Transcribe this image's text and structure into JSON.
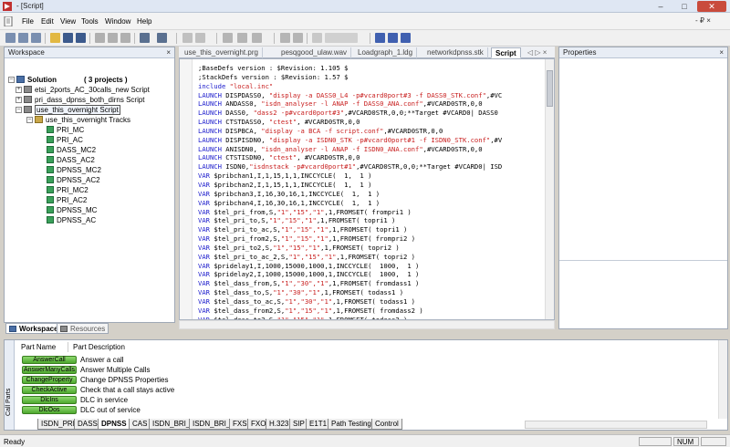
{
  "window": {
    "title": "- [Script]",
    "minimize": "–",
    "maximize": "□",
    "close": "✕"
  },
  "menu": {
    "items": [
      "File",
      "Edit",
      "View",
      "Tools",
      "Window",
      "Help"
    ],
    "mdi_controls": "- ₽ ×"
  },
  "workspace": {
    "title": "Workspace",
    "close": "×",
    "solution_label": "Solution",
    "solution_count": "( 3 projects )",
    "scripts": [
      "etsi_2ports_AC_30calls_new Script",
      "pri_dass_dpnss_both_dirns Script",
      "use_this_overnight Script"
    ],
    "tracks_label": "use_this_overnight Tracks",
    "tracks": [
      "PRI_MC",
      "PRI_AC",
      "DASS_MC2",
      "DASS_AC2",
      "DPNSS_MC2",
      "DPNSS_AC2",
      "PRI_MC2",
      "PRI_AC2",
      "DPNSS_MC",
      "DPNSS_AC"
    ],
    "tabs": [
      "Workspace",
      "Resources"
    ]
  },
  "editor": {
    "tabs": [
      "use_this_overnight.prg",
      "pesqgood_ulaw.wav",
      "Loadgraph_1.ldg",
      "networkdpnss.stk",
      "Script"
    ],
    "active_tab": "Script",
    "tab_nav": "◁ ▷ ×",
    "lines": [
      [
        [
          "cm",
          ";BaseDefs version : $Revision: 1.105 $"
        ]
      ],
      [
        [
          "cm",
          ";StackDefs version : $Revision: 1.57 $"
        ]
      ],
      [
        [
          "kw",
          "include "
        ],
        [
          "st",
          "\"local.inc\""
        ]
      ],
      [
        [
          "kw",
          "LAUNCH "
        ],
        [
          "cm",
          "DISPDASS0, "
        ],
        [
          "st",
          "\"display -a DASS0_L4 -p#vcard0port#3 -f DASS0_STK.conf\""
        ],
        [
          "cm",
          ",#VC"
        ]
      ],
      [
        [
          "kw",
          "LAUNCH "
        ],
        [
          "cm",
          "ANDASS0, "
        ],
        [
          "st",
          "\"isdn_analyser -l ANAP -f DASS0_ANA.conf\""
        ],
        [
          "cm",
          ",#VCARD0STR,0,0"
        ]
      ],
      [
        [
          "kw",
          "LAUNCH "
        ],
        [
          "cm",
          "DASS0, "
        ],
        [
          "st",
          "\"dass2 -p#vcard0port#3\""
        ],
        [
          "cm",
          ",#VCARD0STR,0,0;**Target #VCARD0| DASS0"
        ]
      ],
      [
        [
          "kw",
          "LAUNCH "
        ],
        [
          "cm",
          "CTSTDASS0, "
        ],
        [
          "st",
          "\"ctest\""
        ],
        [
          "cm",
          ", #VCARD0STR,0,0"
        ]
      ],
      [
        [
          "kw",
          "LAUNCH "
        ],
        [
          "cm",
          "DISPBCA, "
        ],
        [
          "st",
          "\"display -a BCA -f script.conf\""
        ],
        [
          "cm",
          ",#VCARD0STR,0,0"
        ]
      ],
      [
        [
          "kw",
          "LAUNCH "
        ],
        [
          "cm",
          "DISPISDN0, "
        ],
        [
          "st",
          "\"display -a ISDN0_STK -p#vcard0port#1 -f ISDN0_STK.conf\""
        ],
        [
          "cm",
          ",#V"
        ]
      ],
      [
        [
          "kw",
          "LAUNCH "
        ],
        [
          "cm",
          "ANISDN0, "
        ],
        [
          "st",
          "\"isdn_analyser -l ANAP -f ISDN0_ANA.conf\""
        ],
        [
          "cm",
          ",#VCARD0STR,0,0"
        ]
      ],
      [
        [
          "kw",
          "LAUNCH "
        ],
        [
          "cm",
          "CTSTISDN0, "
        ],
        [
          "st",
          "\"ctest\""
        ],
        [
          "cm",
          ", #VCARD0STR,0,0"
        ]
      ],
      [
        [
          "kw",
          "LAUNCH "
        ],
        [
          "cm",
          "ISDN0,"
        ],
        [
          "st",
          "\"isdnstack -p#vcard0port#1\""
        ],
        [
          "cm",
          ",#VCARD0STR,0,0;**Target #VCARD0| ISD"
        ]
      ],
      [
        [
          "kw",
          "VAR "
        ],
        [
          "cm",
          "$pribchan1,I,1,15,1,1,INCCYCLE(  1,  1 )"
        ]
      ],
      [
        [
          "kw",
          "VAR "
        ],
        [
          "cm",
          "$pribchan2,I,1,15,1,1,INCCYCLE(  1,  1 )"
        ]
      ],
      [
        [
          "kw",
          "VAR "
        ],
        [
          "cm",
          "$pribchan3,I,16,30,16,1,INCCYCLE(  1,  1 )"
        ]
      ],
      [
        [
          "kw",
          "VAR "
        ],
        [
          "cm",
          "$pribchan4,I,16,30,16,1,INCCYCLE(  1,  1 )"
        ]
      ],
      [
        [
          "kw",
          "VAR "
        ],
        [
          "cm",
          "$tel_pri_from,S,"
        ],
        [
          "st",
          "\"1\",\"15\",\"1\""
        ],
        [
          "cm",
          ",1,FROMSET( frompri1 )"
        ]
      ],
      [
        [
          "kw",
          "VAR "
        ],
        [
          "cm",
          "$tel_pri_to,S,"
        ],
        [
          "st",
          "\"1\",\"15\",\"1\""
        ],
        [
          "cm",
          ",1,FROMSET( topri1 )"
        ]
      ],
      [
        [
          "kw",
          "VAR "
        ],
        [
          "cm",
          "$tel_pri_to_ac,S,"
        ],
        [
          "st",
          "\"1\",\"15\",\"1\""
        ],
        [
          "cm",
          ",1,FROMSET( topri1 )"
        ]
      ],
      [
        [
          "kw",
          "VAR "
        ],
        [
          "cm",
          "$tel_pri_from2,S,"
        ],
        [
          "st",
          "\"1\",\"15\",\"1\""
        ],
        [
          "cm",
          ",1,FROMSET( frompri2 )"
        ]
      ],
      [
        [
          "kw",
          "VAR "
        ],
        [
          "cm",
          "$tel_pri_to2,S,"
        ],
        [
          "st",
          "\"1\",\"15\",\"1\""
        ],
        [
          "cm",
          ",1,FROMSET( topri2 )"
        ]
      ],
      [
        [
          "kw",
          "VAR "
        ],
        [
          "cm",
          "$tel_pri_to_ac_2,S,"
        ],
        [
          "st",
          "\"1\",\"15\",\"1\""
        ],
        [
          "cm",
          ",1,FROMSET( topri2 )"
        ]
      ],
      [
        [
          "kw",
          "VAR "
        ],
        [
          "cm",
          "$pridelay1,I,1000,15000,1000,1,INCCYCLE(  1000,  1 )"
        ]
      ],
      [
        [
          "kw",
          "VAR "
        ],
        [
          "cm",
          "$pridelay2,I,1000,15000,1000,1,INCCYCLE(  1000,  1 )"
        ]
      ],
      [
        [
          "kw",
          "VAR "
        ],
        [
          "cm",
          "$tel_dass_from,S,"
        ],
        [
          "st",
          "\"1\",\"30\",\"1\""
        ],
        [
          "cm",
          ",1,FROMSET( fromdass1 )"
        ]
      ],
      [
        [
          "kw",
          "VAR "
        ],
        [
          "cm",
          "$tel_dass_to,S,"
        ],
        [
          "st",
          "\"1\",\"30\",\"1\""
        ],
        [
          "cm",
          ",1,FROMSET( todass1 )"
        ]
      ],
      [
        [
          "kw",
          "VAR "
        ],
        [
          "cm",
          "$tel_dass_to_ac,S,"
        ],
        [
          "st",
          "\"1\",\"30\",\"1\""
        ],
        [
          "cm",
          ",1,FROMSET( todass1 )"
        ]
      ],
      [
        [
          "kw",
          "VAR "
        ],
        [
          "cm",
          "$tel_dass_from2,S,"
        ],
        [
          "st",
          "\"1\",\"15\",\"1\""
        ],
        [
          "cm",
          ",1,FROMSET( fromdass2 )"
        ]
      ],
      [
        [
          "kw",
          "VAR "
        ],
        [
          "cm",
          "$tel_dass_to2,S,"
        ],
        [
          "st",
          "\"1\",\"15\",\"1\""
        ],
        [
          "cm",
          ",1,FROMSET( todass2 )"
        ]
      ]
    ]
  },
  "properties": {
    "title": "Properties",
    "close": "×"
  },
  "call_parts": {
    "side_label": "Call Parts",
    "columns": [
      "Part Name",
      "Part Description"
    ],
    "rows": [
      {
        "name": "AnswerCall",
        "desc": "Answer a call"
      },
      {
        "name": "AnswerManyCalls",
        "desc": "Answer Multiple Calls"
      },
      {
        "name": "ChangeProperty",
        "desc": "Change DPNSS Properties"
      },
      {
        "name": "CheckActive",
        "desc": "Check that a call stays active"
      },
      {
        "name": "DlcIns",
        "desc": "DLC in service"
      },
      {
        "name": "DlcOos",
        "desc": "DLC out of service"
      }
    ],
    "tabs": [
      "ISDN_PRI",
      "DASS",
      "DPNSS",
      "CAS",
      "ISDN_BRI_S",
      "ISDN_BRI_U",
      "FXS",
      "FXO",
      "H.323",
      "SIP",
      "E1T1",
      "Path Testing",
      "Control"
    ],
    "active_tab": "DPNSS"
  },
  "status": {
    "text": "Ready",
    "num": "NUM"
  },
  "colors": {
    "keyword": "#1a1acc",
    "string": "#c81e1e",
    "part_button": "#5cb83a"
  }
}
